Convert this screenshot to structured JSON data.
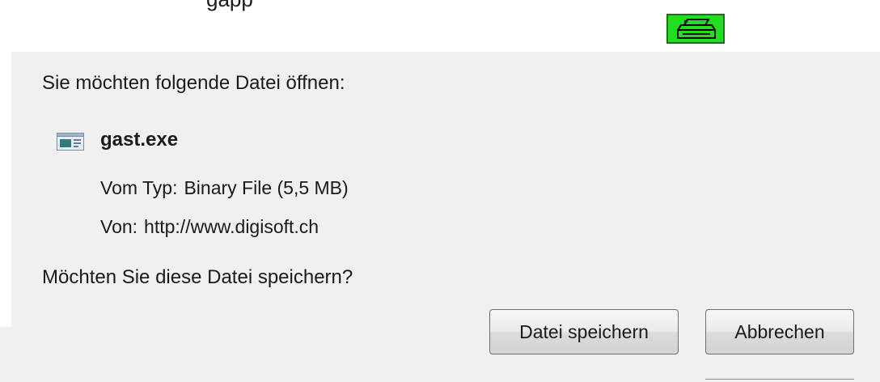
{
  "background": {
    "partial_text": "gapp",
    "printer_icon": "printer-icon",
    "printer_color": "#22dd22"
  },
  "dialog": {
    "prompt": "Sie möchten folgende Datei öffnen:",
    "file": {
      "icon": "application-file-icon",
      "name": "gast.exe",
      "type_label": "Vom Typ:",
      "type_value": "Binary File (5,5 MB)",
      "from_label": "Von:",
      "from_value": "http://www.digisoft.ch"
    },
    "question": "Möchten Sie diese Datei speichern?",
    "buttons": {
      "save": "Datei speichern",
      "cancel": "Abbrechen"
    },
    "background_color": "#f0f0f0"
  }
}
